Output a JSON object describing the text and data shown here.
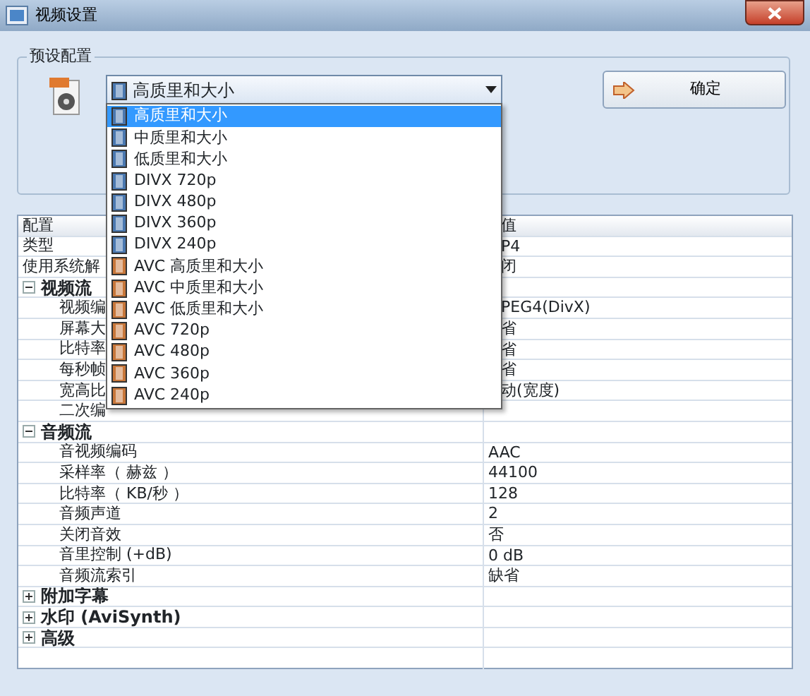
{
  "window": {
    "title": "视频设置"
  },
  "preset": {
    "label": "预设配置",
    "combo_value": "高质里和大小",
    "confirm": "确定"
  },
  "dropdown": [
    {
      "label": "高质里和大小",
      "selected": true,
      "color": "#4a78b0"
    },
    {
      "label": "中质里和大小",
      "selected": false,
      "color": "#4a78b0"
    },
    {
      "label": "低质里和大小",
      "selected": false,
      "color": "#4a78b0"
    },
    {
      "label": "DIVX 720p",
      "selected": false,
      "color": "#4a78b0"
    },
    {
      "label": "DIVX 480p",
      "selected": false,
      "color": "#4a78b0"
    },
    {
      "label": "DIVX 360p",
      "selected": false,
      "color": "#4a78b0"
    },
    {
      "label": "DIVX 240p",
      "selected": false,
      "color": "#4a78b0"
    },
    {
      "label": "AVC 高质里和大小",
      "selected": false,
      "color": "#c8773a"
    },
    {
      "label": "AVC 中质里和大小",
      "selected": false,
      "color": "#c8773a"
    },
    {
      "label": "AVC 低质里和大小",
      "selected": false,
      "color": "#c8773a"
    },
    {
      "label": "AVC 720p",
      "selected": false,
      "color": "#c8773a"
    },
    {
      "label": "AVC 480p",
      "selected": false,
      "color": "#c8773a"
    },
    {
      "label": "AVC 360p",
      "selected": false,
      "color": "#c8773a"
    },
    {
      "label": "AVC 240p",
      "selected": false,
      "color": "#c8773a"
    }
  ],
  "table": {
    "columns": [
      "配置",
      "值"
    ],
    "rows": [
      {
        "kind": "row",
        "name": "类型",
        "value": "P4"
      },
      {
        "kind": "row",
        "name": "使用系统解",
        "value": "闭"
      },
      {
        "kind": "section",
        "name": "视频流",
        "expanded": true
      },
      {
        "kind": "subrow",
        "name": "视频编",
        "value": "PEG4(DivX)"
      },
      {
        "kind": "subrow",
        "name": "屏幕大",
        "value": "省"
      },
      {
        "kind": "subrow",
        "name": "比特率",
        "value": "省"
      },
      {
        "kind": "subrow",
        "name": "每秒帧",
        "value": "省"
      },
      {
        "kind": "subrow",
        "name": "宽高比",
        "value": "动(宽度)"
      },
      {
        "kind": "subrow",
        "name": "二次编"
      },
      {
        "kind": "section",
        "name": "音频流",
        "expanded": true
      },
      {
        "kind": "subrow",
        "name": "音视频编码",
        "value": "AAC"
      },
      {
        "kind": "subrow",
        "name": "采样率（ 赫兹 ）",
        "value": "44100"
      },
      {
        "kind": "subrow",
        "name": "比特率（ KB/秒 ）",
        "value": "128"
      },
      {
        "kind": "subrow",
        "name": "音频声道",
        "value": "2"
      },
      {
        "kind": "subrow",
        "name": "关闭音效",
        "value": "否"
      },
      {
        "kind": "subrow",
        "name": "音里控制 (+dB)",
        "value": "0 dB"
      },
      {
        "kind": "subrow",
        "name": "音频流索引",
        "value": "缺省"
      },
      {
        "kind": "section",
        "name": "附加字幕",
        "expanded": false
      },
      {
        "kind": "section",
        "name": "水印 (AviSynth)",
        "expanded": false
      },
      {
        "kind": "section",
        "name": "高级",
        "expanded": false
      }
    ]
  }
}
